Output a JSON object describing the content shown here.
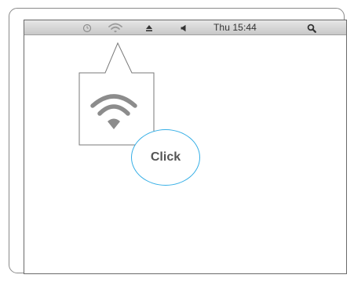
{
  "menubar": {
    "icons": [
      "time-machine-icon",
      "wifi-icon",
      "eject-icon",
      "volume-icon",
      "spotlight-search-icon"
    ],
    "clock": "Thu 15:44"
  },
  "callout": {
    "icon": "wifi-icon"
  },
  "instruction": {
    "label": "Click",
    "accent_color": "#34aee6"
  }
}
